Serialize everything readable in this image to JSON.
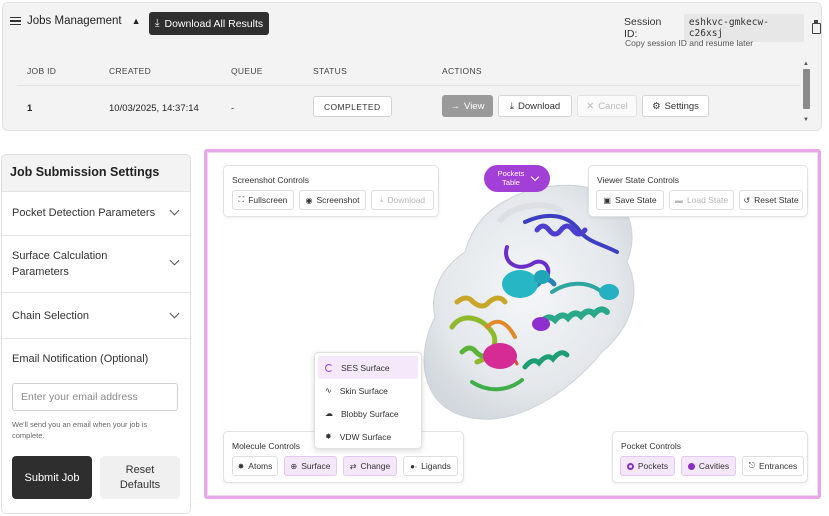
{
  "jobs": {
    "toggle_label": "Jobs Management",
    "download_all_label": "Download All Results",
    "session_label": "Session ID:",
    "session_id": "eshkvc-gmkecw-c26xsj",
    "session_hint": "Copy session ID and resume later",
    "columns": [
      "JOB ID",
      "CREATED",
      "QUEUE",
      "STATUS",
      "ACTIONS"
    ],
    "rows": [
      {
        "id": "1",
        "created": "10/03/2025, 14:37:14",
        "queue": "-",
        "status": "COMPLETED"
      }
    ],
    "actions": {
      "view": "View",
      "download": "Download",
      "cancel": "Cancel",
      "settings": "Settings"
    }
  },
  "settings": {
    "title": "Job Submission Settings",
    "sections": [
      "Pocket Detection Parameters",
      "Surface Calculation Parameters",
      "Chain Selection"
    ],
    "email_title": "Email Notification (Optional)",
    "email_placeholder": "Enter your email address",
    "email_note": "We'll send you an email when your job is complete.",
    "submit_label": "Submit Job",
    "reset_label": "Reset Defaults"
  },
  "viewer": {
    "screenshot_controls": {
      "title": "Screenshot Controls",
      "fullscreen": "Fullscreen",
      "screenshot": "Screenshot",
      "download": "Download"
    },
    "pockets_table_label": "Pockets Table",
    "state_controls": {
      "title": "Viewer State Controls",
      "save": "Save State",
      "load": "Load State",
      "reset": "Reset State"
    },
    "surface_menu": [
      "SES Surface",
      "Skin Surface",
      "Blobby Surface",
      "VDW Surface"
    ],
    "molecule_controls": {
      "title": "Molecule Controls",
      "atoms": "Atoms",
      "surface": "Surface",
      "change": "Change",
      "ligands": "Ligands"
    },
    "pocket_controls": {
      "title": "Pocket Controls",
      "pockets": "Pockets",
      "cavities": "Cavities",
      "entrances": "Entrances"
    }
  },
  "colors": {
    "accent": "#a23fd6",
    "viewer_border": "#e6a8e6",
    "primary_button": "#2e2e2e"
  }
}
